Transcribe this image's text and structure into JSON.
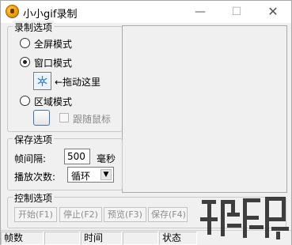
{
  "window": {
    "title": "小小gif录制",
    "controls": {
      "minimize": "—",
      "maximize": "☐",
      "close": "✕"
    }
  },
  "record_options": {
    "title": "录制选项",
    "radios": [
      {
        "label": "全屏模式",
        "selected": false
      },
      {
        "label": "窗口模式",
        "selected": true
      },
      {
        "label": "区域模式",
        "selected": false
      }
    ],
    "drag_hint": "←拖动这里",
    "follow_mouse": {
      "label": "跟随鼠标",
      "checked": false,
      "enabled": false
    }
  },
  "save_options": {
    "title": "保存选项",
    "interval_label": "帧间隔:",
    "interval_value": "500",
    "interval_unit": "毫秒",
    "loop_label": "播放次数:",
    "loop_value": "循环"
  },
  "control_options": {
    "title": "控制选项",
    "buttons": [
      "开始(F1)",
      "停止(F2)",
      "预览(F3)",
      "保存(F4)"
    ]
  },
  "statusbar": {
    "cells": [
      "帧数",
      "",
      "时间",
      "",
      "状态"
    ]
  },
  "icons": {
    "app": "gif-recorder-icon",
    "drag_target": "crosshair-snowflake-icon"
  }
}
